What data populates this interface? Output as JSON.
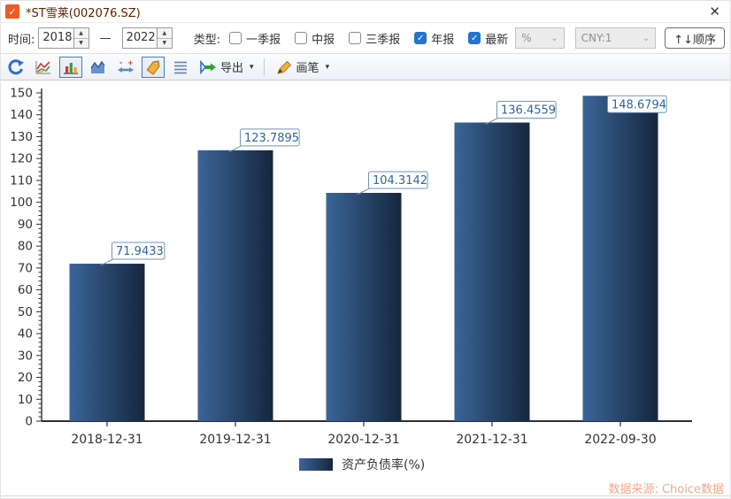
{
  "window": {
    "title": "*ST雪莱(002076.SZ)",
    "close_glyph": "✕",
    "checkbox_glyph": "✓"
  },
  "filters": {
    "time_label": "时间:",
    "time_from": "2018",
    "time_to": "2022",
    "dash": "—",
    "type_label": "类型:",
    "report_types": [
      {
        "label": "一季报",
        "checked": false
      },
      {
        "label": "中报",
        "checked": false
      },
      {
        "label": "三季报",
        "checked": false
      },
      {
        "label": "年报",
        "checked": true
      },
      {
        "label": "最新",
        "checked": true
      }
    ],
    "unit_dropdown": "%",
    "currency_dropdown": "CNY:1",
    "order_button": "↑↓顺序"
  },
  "toolbar": {
    "export_label": "导出",
    "brush_label": "画笔",
    "caret": "▾",
    "icons": [
      {
        "name": "refresh",
        "selected": false
      },
      {
        "name": "line-chart",
        "selected": false
      },
      {
        "name": "bar-chart",
        "selected": true
      },
      {
        "name": "area-chart",
        "selected": false
      },
      {
        "name": "scale-range",
        "selected": false
      },
      {
        "name": "data-label-tag",
        "selected": true
      },
      {
        "name": "grid-rows",
        "selected": false
      },
      {
        "name": "export",
        "selected": false
      },
      {
        "name": "brush",
        "selected": false
      }
    ]
  },
  "chart_data": {
    "type": "bar",
    "title": "",
    "categories": [
      "2018-12-31",
      "2019-12-31",
      "2020-12-31",
      "2021-12-31",
      "2022-09-30"
    ],
    "values": [
      71.9433,
      123.7895,
      104.3142,
      136.4559,
      148.6794
    ],
    "value_labels": [
      "71.9433",
      "123.7895",
      "104.3142",
      "136.4559",
      "148.6794"
    ],
    "legend": "资产负债率(%)",
    "xlabel": "",
    "ylabel": "",
    "ylim": [
      0,
      150
    ],
    "ytick_step": 10,
    "grid": false,
    "legend_position": "bottom",
    "bar_gradient": [
      "#3a6598",
      "#16263e"
    ],
    "axis_color": "#2f2f2f",
    "tick_label_color": "#333333",
    "label_box_border": "#6f94bb",
    "label_text_color": "#31659c"
  },
  "footer": {
    "watermark": "数据来源: Choice数据"
  }
}
